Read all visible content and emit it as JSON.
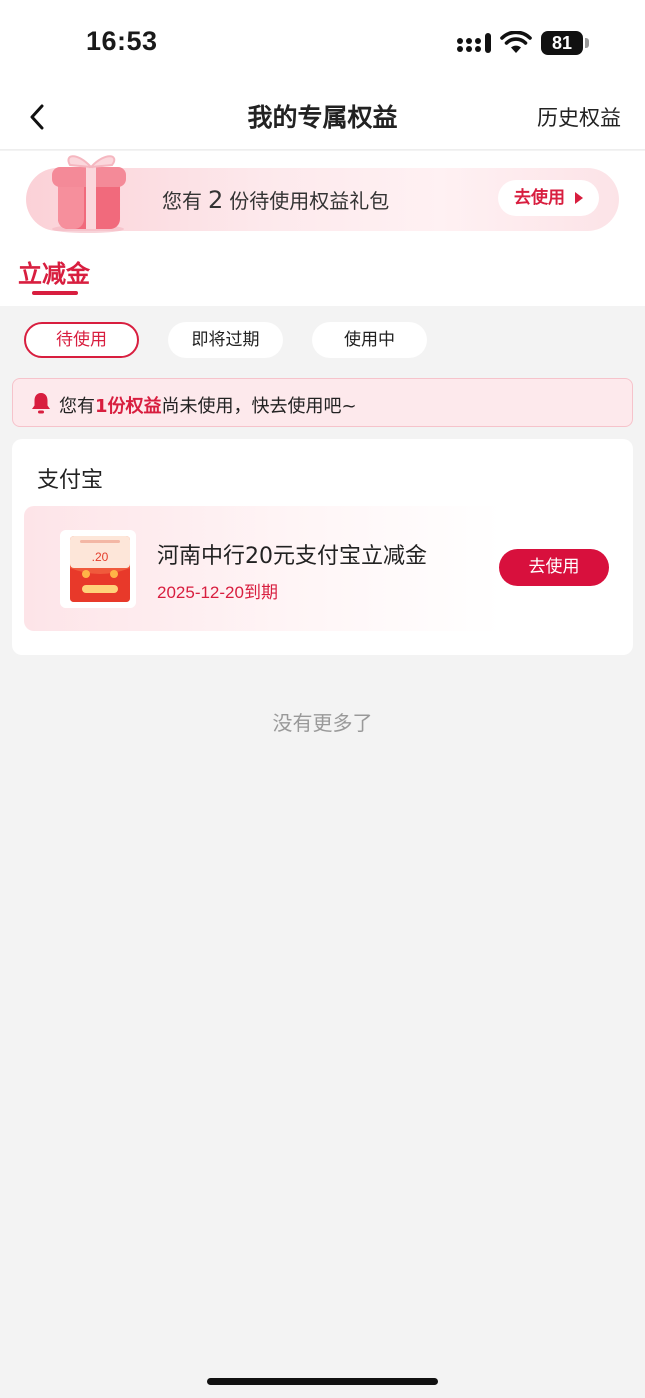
{
  "status_bar": {
    "time": "16:53",
    "battery": "81"
  },
  "nav": {
    "title": "我的专属权益",
    "history": "历史权益"
  },
  "banner": {
    "prefix": "您有",
    "count": "2",
    "suffix": "份待使用权益礼包",
    "button": "去使用"
  },
  "category_tab": "立减金",
  "filters": [
    "待使用",
    "即将过期",
    "使用中"
  ],
  "active_filter": "待使用",
  "notice": {
    "prefix": "您有",
    "highlight": "1份权益",
    "suffix": "尚未使用，快去使用吧~"
  },
  "card": {
    "title": "支付宝",
    "coupon": {
      "thumb_value": ".20",
      "name": "河南中行20元支付宝立减金",
      "expiry": "2025-12-20到期",
      "button": "去使用"
    }
  },
  "footer_text": "没有更多了",
  "colors": {
    "accent": "#d81e3f",
    "background": "#f3f3f3"
  }
}
